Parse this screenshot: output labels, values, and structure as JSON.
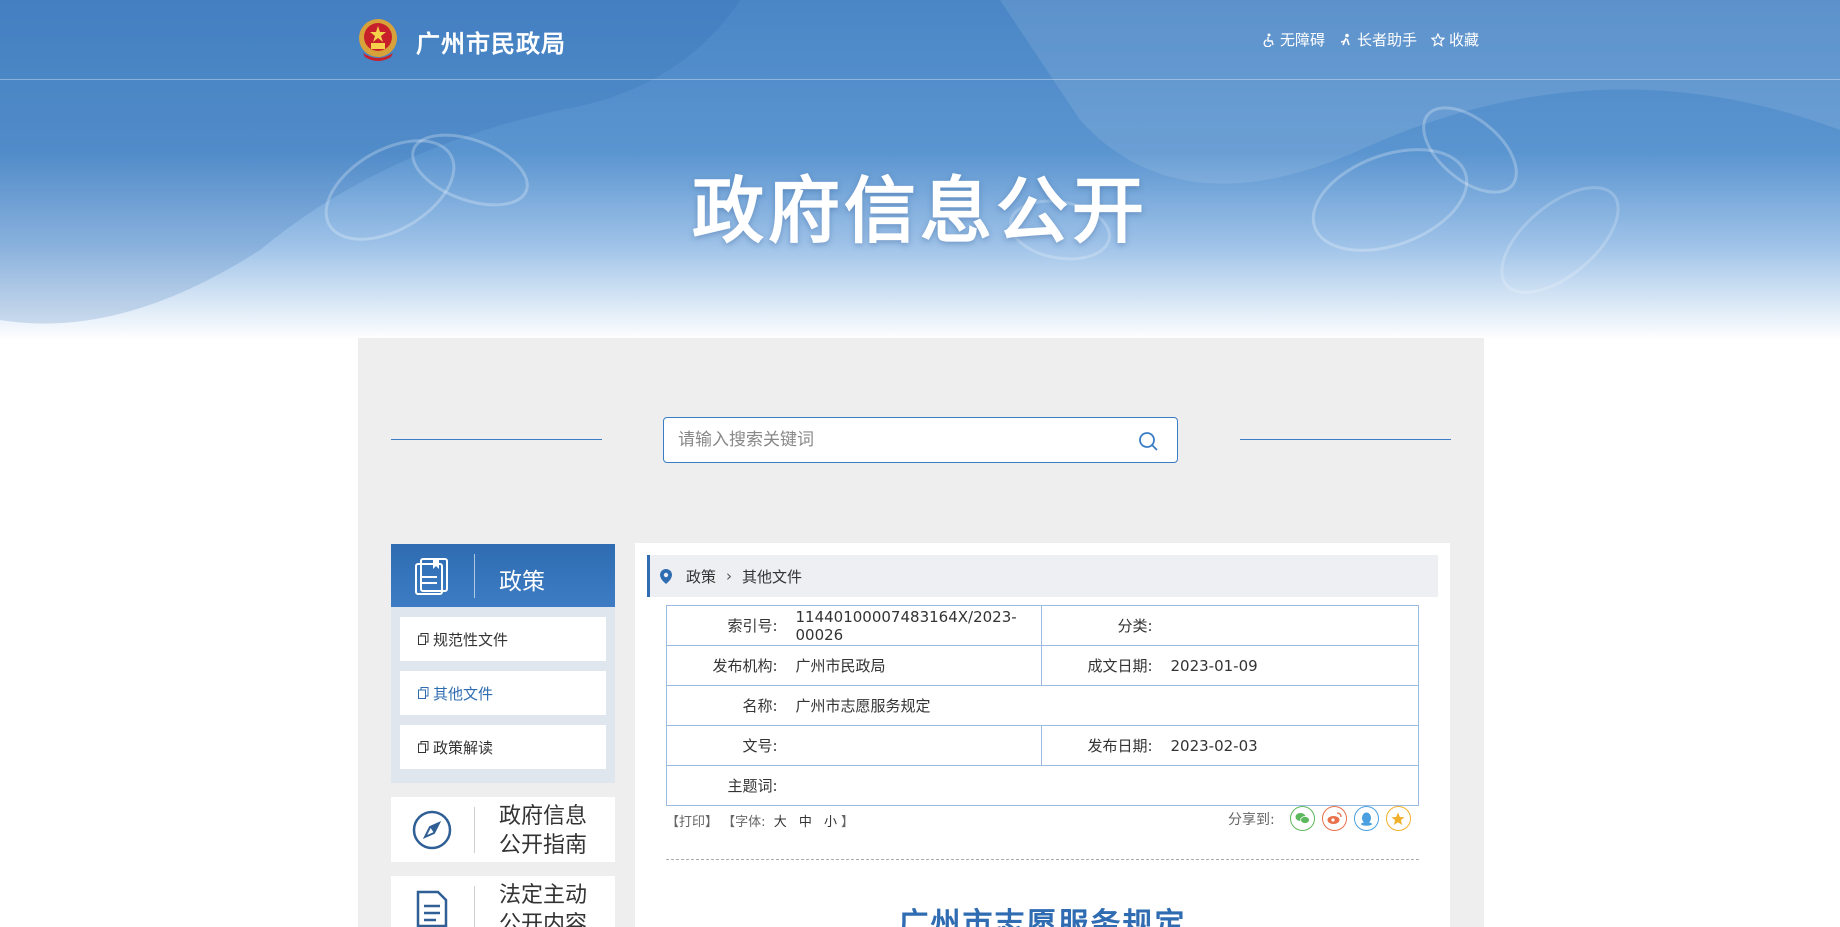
{
  "header": {
    "site_name": "广州市民政局",
    "links": [
      {
        "label": "无障碍",
        "icon": "accessibility-icon"
      },
      {
        "label": "长者助手",
        "icon": "elder-helper-icon"
      },
      {
        "label": "收藏",
        "icon": "star-icon"
      }
    ],
    "banner_title": "政府信息公开"
  },
  "search": {
    "placeholder": "请输入搜索关键词",
    "value": ""
  },
  "sidebar": {
    "head": {
      "label": "政策",
      "icon": "book-icon"
    },
    "items": [
      {
        "label": "规范性文件",
        "active": false
      },
      {
        "label": "其他文件",
        "active": true
      },
      {
        "label": "政策解读",
        "active": false
      }
    ],
    "blocks": [
      {
        "label": "政府信息公开指南",
        "icon": "compass-icon"
      },
      {
        "label": "法定主动公开内容",
        "icon": "document-icon"
      }
    ]
  },
  "breadcrumb": {
    "items": [
      "政策",
      "其他文件"
    ]
  },
  "meta": {
    "index_no": {
      "label": "索引号:",
      "value": "11440100007483164X/2023-00026"
    },
    "category": {
      "label": "分类:",
      "value": ""
    },
    "publisher": {
      "label": "发布机构:",
      "value": "广州市民政局"
    },
    "written_date": {
      "label": "成文日期:",
      "value": "2023-01-09"
    },
    "name": {
      "label": "名称:",
      "value": "广州市志愿服务规定"
    },
    "doc_no": {
      "label": "文号:",
      "value": ""
    },
    "publish_date": {
      "label": "发布日期:",
      "value": "2023-02-03"
    },
    "keywords": {
      "label": "主题词:",
      "value": ""
    }
  },
  "tools": {
    "print": "【打印】",
    "font_prefix": "【字体:",
    "font_large": "大",
    "font_medium": "中",
    "font_small": "小",
    "font_suffix": "】",
    "share_label": "分享到:"
  },
  "share_icons": [
    {
      "name": "wechat-icon",
      "color": "#5cb85c"
    },
    {
      "name": "weibo-icon",
      "color": "#e8704a"
    },
    {
      "name": "qq-icon",
      "color": "#4a9fe0"
    },
    {
      "name": "qzone-icon",
      "color": "#f0b02a"
    }
  ],
  "article": {
    "title": "广州市志愿服务规定"
  },
  "colors": {
    "accent": "#2f6cb2",
    "banner": "#4a86c6",
    "panel": "#eeeeee"
  }
}
